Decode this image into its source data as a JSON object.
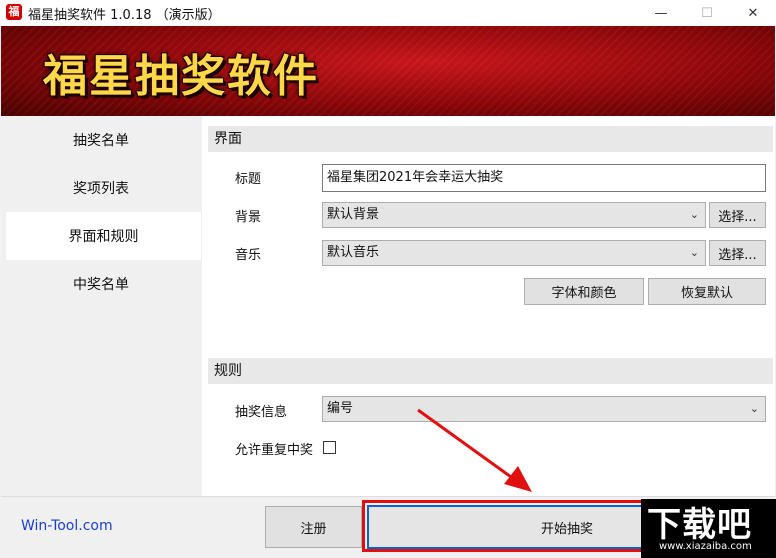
{
  "window": {
    "title": "福星抽奖软件 1.0.18 （演示版）",
    "app_icon_glyph": "福",
    "controls": {
      "minimize": "—",
      "maximize": "☐",
      "close": "✕"
    }
  },
  "banner": {
    "title": "福星抽奖软件"
  },
  "sidebar": {
    "items": [
      {
        "label": "抽奖名单",
        "active": false
      },
      {
        "label": "奖项列表",
        "active": false
      },
      {
        "label": "界面和规则",
        "active": true
      },
      {
        "label": "中奖名单",
        "active": false
      }
    ]
  },
  "interface_section": {
    "header": "界面",
    "title_label": "标题",
    "title_value": "福星集团2021年会幸运大抽奖",
    "background_label": "背景",
    "background_value": "默认背景",
    "background_choose": "选择...",
    "music_label": "音乐",
    "music_value": "默认音乐",
    "music_choose": "选择...",
    "font_color_button": "字体和颜色",
    "restore_default_button": "恢复默认"
  },
  "rules_section": {
    "header": "规则",
    "info_label": "抽奖信息",
    "info_value": "编号",
    "allow_repeat_label": "允许重复中奖",
    "allow_repeat_checked": false
  },
  "bottom": {
    "site_link": "Win-Tool.com",
    "register_button": "注册",
    "start_button": "开始抽奖"
  },
  "annotation": {
    "highlight_color": "#e01010",
    "arrow_color": "#e01010"
  },
  "watermark": {
    "logo": "下载吧",
    "url": "www.xiazaiba.com"
  },
  "colors": {
    "banner_red": "#9b0a0d",
    "banner_text": "#ffd84a",
    "link_blue": "#1a3fd1",
    "focus_blue": "#0a64c8"
  }
}
